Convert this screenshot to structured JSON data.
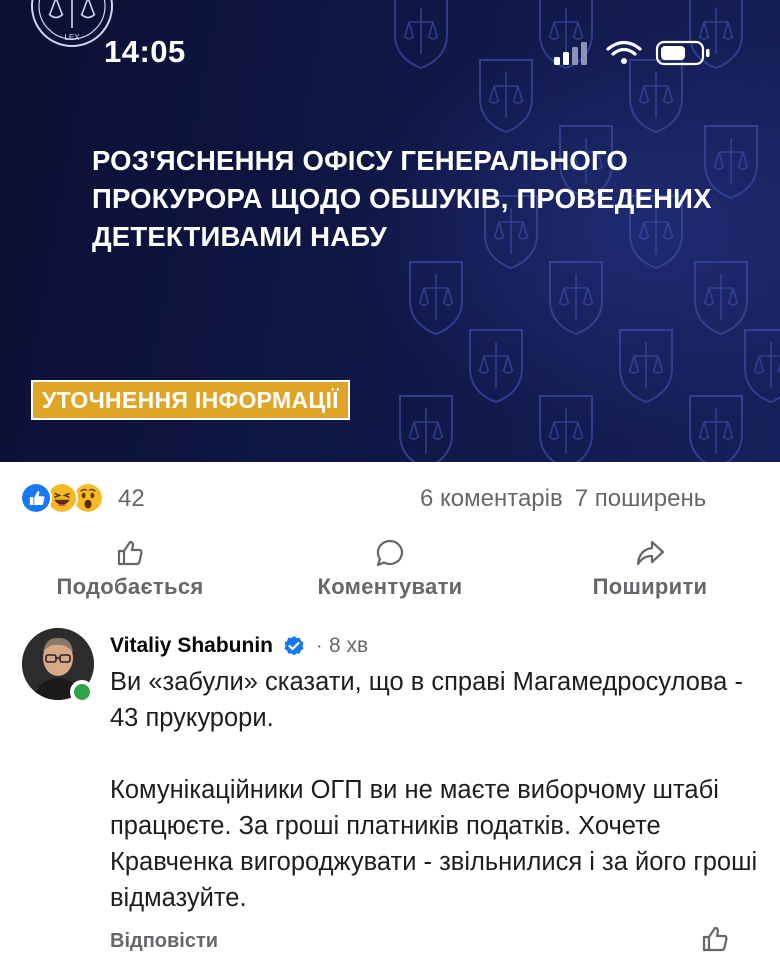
{
  "status_bar": {
    "time": "14:05",
    "icons": [
      "cellular-signal-icon",
      "wifi-icon",
      "battery-icon"
    ]
  },
  "banner": {
    "title": "РОЗ'ЯСНЕННЯ ОФІСУ ГЕНЕРАЛЬНОГО ПРОКУРОРА ЩОДО ОБШУКІВ, ПРОВЕДЕНИХ ДЕТЕКТИВАМИ НАБУ",
    "tag": "УТОЧНЕННЯ ІНФОРМАЦІЇ",
    "logo_text": "LEX",
    "colors": {
      "background": "#101848",
      "tag": "#e0a526"
    }
  },
  "stats": {
    "reactions": [
      "like-reaction-icon",
      "haha-reaction-icon",
      "wow-reaction-icon"
    ],
    "reaction_count": "42",
    "comments": "6 коментарів",
    "shares": "7 поширень"
  },
  "actions": {
    "like": "Подобається",
    "comment": "Коментувати",
    "share": "Поширити"
  },
  "comment": {
    "author": "Vitaliy Shabunin",
    "verified": true,
    "time": "8 хв",
    "body": "Ви «забули» сказати, що в справі Магамедросулова - 43 прукурори.\n\nКомунікаційники ОГП ви не маєте виборчому штабі працюєте. За гроші платників податків. Хочете Кравченка вигороджувати - звільнилися і за його гроші відмазуйте.",
    "reply_label": "Відповісти",
    "online": true,
    "colors": {
      "online": "#31a24c",
      "verified": "#1877f2"
    }
  }
}
